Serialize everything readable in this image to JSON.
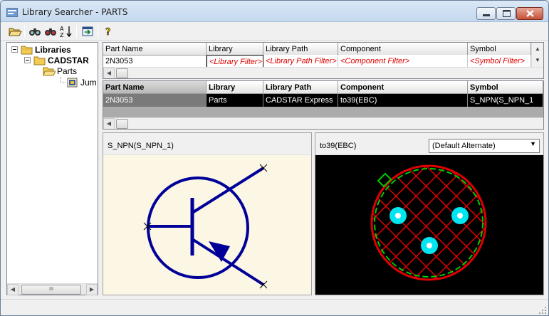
{
  "window": {
    "title": "Library Searcher - PARTS",
    "controls": {
      "minimize": "minimize",
      "maximize": "maximize",
      "close": "close"
    }
  },
  "toolbar": {
    "icons": [
      "open-folder-icon",
      "find-icon",
      "find-next-icon",
      "sort-az-icon",
      "export-icon",
      "help-icon"
    ]
  },
  "tree": {
    "items": [
      {
        "label": "Libraries",
        "expander": "−"
      },
      {
        "label": "CADSTAR",
        "expander": "−"
      },
      {
        "label": "Parts",
        "expander": ""
      },
      {
        "label": "Jump",
        "expander": ""
      }
    ],
    "scroll_thumb": "III"
  },
  "filter_grid": {
    "columns": [
      "Part Name",
      "Library",
      "Library Path",
      "Component",
      "Symbol"
    ],
    "row": [
      "2N3053",
      "<Library Filter>",
      "<Library Path Filter>",
      "<Component Filter>",
      "<Symbol Filter>"
    ]
  },
  "results_grid": {
    "columns": [
      "Part Name",
      "Library",
      "Library Path",
      "Component",
      "Symbol"
    ],
    "rows": [
      [
        "2N3053",
        "Parts",
        "CADSTAR Express",
        "to39(EBC)",
        "S_NPN(S_NPN_1"
      ]
    ]
  },
  "symbol_preview": {
    "caption": "S_NPN(S_NPN_1)",
    "background": "#fcf6e4",
    "line_color": "#000099"
  },
  "footprint_preview": {
    "caption": "to39(EBC)",
    "alternate": "(Default Alternate)",
    "background": "#000000",
    "pad_color": "#e00000",
    "outline_color": "#00cc00",
    "pin_color": "#00e5f0"
  },
  "status": {
    "text": ""
  }
}
